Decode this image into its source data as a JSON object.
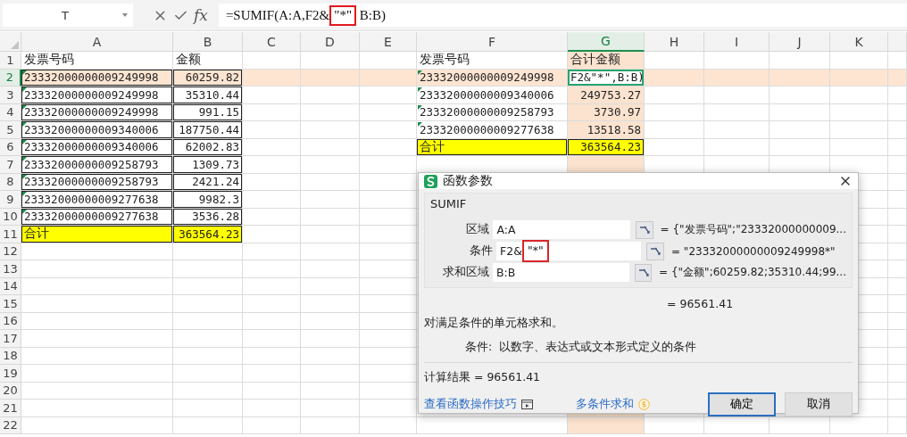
{
  "formula_bar": {
    "name_box": "T",
    "fx_label": "fx",
    "formula_before": "=SUMIF(A:A,F2&",
    "formula_marked": "\"*\"",
    "formula_after": " B:B)"
  },
  "sheet": {
    "columns": [
      {
        "label": "A",
        "selected": false
      },
      {
        "label": "B",
        "selected": false
      },
      {
        "label": "C",
        "selected": false
      },
      {
        "label": "D",
        "selected": false
      },
      {
        "label": "E",
        "selected": false
      },
      {
        "label": "F",
        "selected": false
      },
      {
        "label": "G",
        "selected": true
      },
      {
        "label": "H",
        "selected": false
      },
      {
        "label": "I",
        "selected": false
      },
      {
        "label": "J",
        "selected": false
      },
      {
        "label": "K",
        "selected": false
      }
    ],
    "rows": [
      {
        "number": "1",
        "selected": false
      },
      {
        "number": "2",
        "selected": true
      },
      {
        "number": "3",
        "selected": false
      },
      {
        "number": "4",
        "selected": false
      },
      {
        "number": "5",
        "selected": false
      },
      {
        "number": "6",
        "selected": false
      },
      {
        "number": "7",
        "selected": false
      },
      {
        "number": "8",
        "selected": false
      },
      {
        "number": "9",
        "selected": false
      },
      {
        "number": "10",
        "selected": false
      },
      {
        "number": "11",
        "selected": false
      },
      {
        "number": "12",
        "selected": false
      },
      {
        "number": "13",
        "selected": false
      },
      {
        "number": "14",
        "selected": false
      },
      {
        "number": "15",
        "selected": false
      },
      {
        "number": "16",
        "selected": false
      },
      {
        "number": "17",
        "selected": false
      },
      {
        "number": "18",
        "selected": false
      },
      {
        "number": "19",
        "selected": false
      },
      {
        "number": "20",
        "selected": false
      },
      {
        "number": "21",
        "selected": false
      },
      {
        "number": "22",
        "selected": false
      }
    ],
    "left_table": {
      "header": [
        "发票号码",
        "金额"
      ],
      "bordered": true,
      "rows": [
        {
          "cells": [
            "23332000000009249998",
            "60259.82"
          ],
          "editing": false
        },
        {
          "cells": [
            "23332000000009249998",
            "35310.44"
          ],
          "editing": false
        },
        {
          "cells": [
            "23332000000009249998",
            "991.15"
          ],
          "editing": false
        },
        {
          "cells": [
            "23332000000009340006",
            "187750.44"
          ],
          "editing": false
        },
        {
          "cells": [
            "23332000000009340006",
            "62002.83"
          ],
          "editing": false
        },
        {
          "cells": [
            "23332000000009258793",
            "1309.73"
          ],
          "editing": false
        },
        {
          "cells": [
            "23332000000009258793",
            "2421.24"
          ],
          "editing": false
        },
        {
          "cells": [
            "23332000000009277638",
            "9982.3"
          ],
          "editing": false
        },
        {
          "cells": [
            "23332000000009277638",
            "3536.28"
          ],
          "editing": false
        }
      ],
      "total": [
        "合计",
        "363564.23"
      ]
    },
    "right_table": {
      "header": [
        "发票号码",
        "合计金额"
      ],
      "bordered": false,
      "rows": [
        {
          "cells": [
            "23332000000009249998",
            "F2&\"*\",B:B)"
          ],
          "editing": true
        },
        {
          "cells": [
            "23332000000009340006",
            "249753.27"
          ],
          "editing": false
        },
        {
          "cells": [
            "23332000000009258793",
            "3730.97"
          ],
          "editing": false
        },
        {
          "cells": [
            "23332000000009277638",
            "13518.58"
          ],
          "editing": false
        }
      ],
      "total": [
        "合计",
        "363564.23"
      ]
    }
  },
  "dialog": {
    "title": "函数参数",
    "function_name": "SUMIF",
    "arguments": [
      {
        "label": "区域",
        "value": "A:A",
        "result": "= {\"发票号码\";\"23332000000009..."
      },
      {
        "label": "条件",
        "value": "F2&",
        "marked": "\"*\"",
        "result": "= \"23332000000009249998*\""
      },
      {
        "label": "求和区域",
        "value": "B:B",
        "result": "= {\"金额\";60259.82;35310.44;99..."
      }
    ],
    "formula_result": "= 96561.41",
    "description": "对满足条件的单元格求和。",
    "argument_help": "条件:  以数字、表达式或文本形式定义的条件",
    "calc_result": "计算结果 = 96561.41",
    "links": [
      "查看函数操作技巧",
      "多条件求和"
    ],
    "buttons": [
      {
        "label": "确定",
        "primary": true
      },
      {
        "label": "取消",
        "primary": false
      }
    ]
  }
}
